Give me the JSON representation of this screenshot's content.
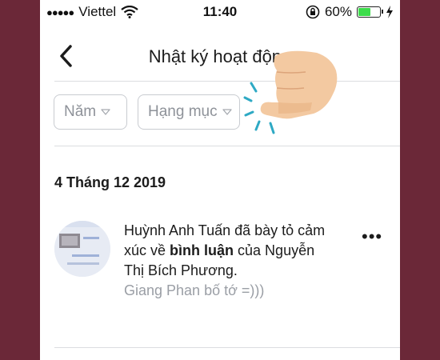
{
  "status_bar": {
    "carrier": "Viettel",
    "time": "11:40",
    "battery": "60%",
    "battery_level": 0.6,
    "icons": [
      "signal-dots-icon",
      "wifi-icon",
      "orientation-lock-icon",
      "battery-icon",
      "charging-icon"
    ]
  },
  "header": {
    "title": "Nhật ký hoạt động",
    "back_icon": "chevron-left-icon"
  },
  "filters": [
    {
      "label": "Năm"
    },
    {
      "label": "Hạng mục"
    }
  ],
  "section": {
    "date": "4 Tháng 12 2019"
  },
  "activity": {
    "actor": "Huỳnh Anh Tuấn",
    "text_before": " đã bày tỏ cảm xúc về ",
    "highlight": "bình luận",
    "text_after": " của Nguyễn Thị Bích Phương.",
    "comment": "Giang Phan bố tớ =)))",
    "more_label": "•••"
  },
  "colors": {
    "background": "#6b2838",
    "battery_fill": "#3ddc4b",
    "placeholder_gray": "#9a9ea5",
    "border_gray": "#c9ccd1",
    "hand_skin": "#f3c9a1",
    "tap_lines": "#2ea9c4"
  }
}
